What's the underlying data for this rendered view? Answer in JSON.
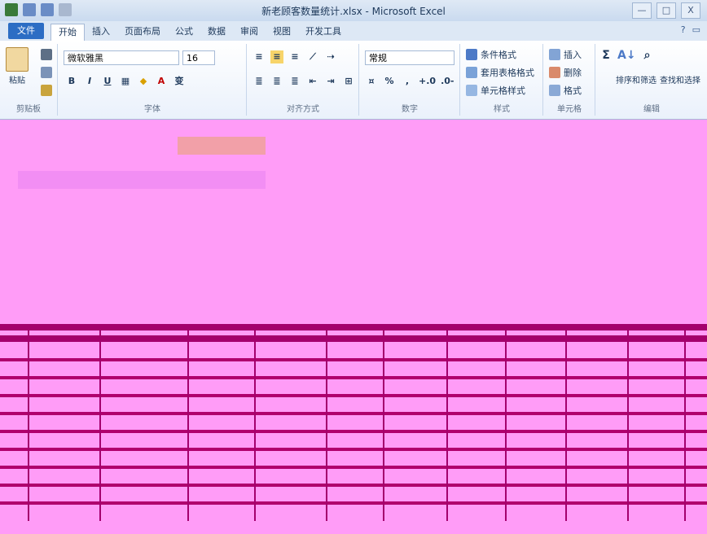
{
  "window": {
    "title": "新老顾客数量统计.xlsx - Microsoft Excel",
    "buttons": [
      "—",
      "□",
      "X"
    ]
  },
  "tabs": {
    "file": "文件",
    "items": [
      "开始",
      "插入",
      "页面布局",
      "公式",
      "数据",
      "审阅",
      "视图",
      "开发工具"
    ],
    "active": "开始"
  },
  "ribbon": {
    "clipboard": {
      "paste_label": "粘贴",
      "group_label": "剪贴板"
    },
    "font": {
      "family": "微软雅黑",
      "size": "16",
      "group_label": "字体"
    },
    "alignment": {
      "group_label": "对齐方式"
    },
    "number": {
      "format": "常规",
      "group_label": "数字"
    },
    "styles": {
      "items": [
        "条件格式",
        "套用表格格式",
        "单元格样式"
      ],
      "group_label": "样式"
    },
    "cells": {
      "items": [
        "插入",
        "删除",
        "格式"
      ],
      "group_label": "单元格"
    },
    "editing": {
      "items": [
        "排序和筛选",
        "查找和选择"
      ],
      "group_label": "编辑"
    }
  },
  "colors": {
    "sheet_bg": "#ff9cf7",
    "band_dark": "#a4006d",
    "accent_blue": "#2c6dc4"
  }
}
